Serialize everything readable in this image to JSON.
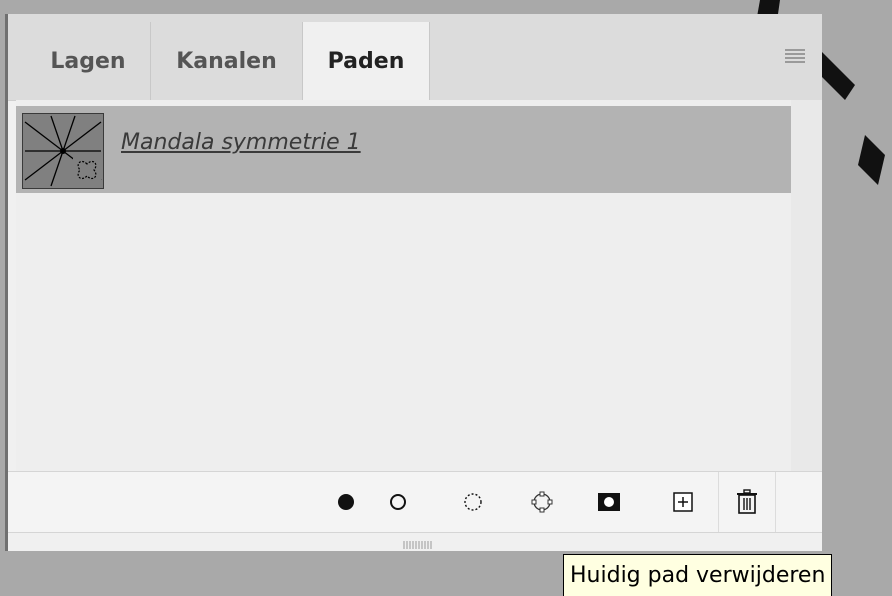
{
  "tabs": [
    {
      "label": "Lagen",
      "active": false
    },
    {
      "label": "Kanalen",
      "active": false
    },
    {
      "label": "Paden",
      "active": true
    }
  ],
  "paths": [
    {
      "name": "Mandala symmetrie 1",
      "selected": true
    }
  ],
  "footer_buttons": [
    {
      "icon": "fill-path-icon"
    },
    {
      "icon": "stroke-path-icon"
    },
    {
      "icon": "load-selection-icon"
    },
    {
      "icon": "make-path-from-selection-icon"
    },
    {
      "icon": "add-mask-icon"
    },
    {
      "icon": "new-path-icon"
    },
    {
      "icon": "delete-path-icon"
    }
  ],
  "tooltip": {
    "text": "Huidig pad verwijderen"
  },
  "colors": {
    "panel_bg": "#f0f0f0",
    "tabbar_bg": "#dcdcdc",
    "selected_row": "#b3b3b3",
    "tooltip_bg": "#ffffe1"
  }
}
